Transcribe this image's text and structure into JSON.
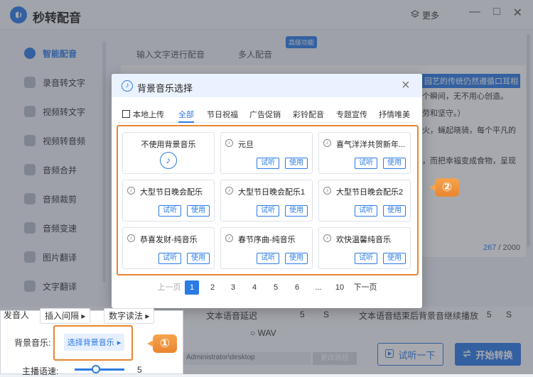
{
  "app": {
    "title": "秒转配音",
    "more": "更多"
  },
  "sidebar": {
    "items": [
      {
        "label": "智能配音",
        "active": true
      },
      {
        "label": "录音转文字"
      },
      {
        "label": "视频转文字"
      },
      {
        "label": "视频转音频"
      },
      {
        "label": "音频合并"
      },
      {
        "label": "音频裁剪"
      },
      {
        "label": "音频变速"
      },
      {
        "label": "图片翻译"
      },
      {
        "label": "文字翻译"
      }
    ]
  },
  "tabs": {
    "input_text": "输入文字进行配音",
    "multi": "多人配音",
    "badge": "高级功能"
  },
  "editor": {
    "highlight": "园艺的传统仍然遵循口耳相",
    "snip1": "个瞬间，无不用心创造。",
    "snip2": "劳和坚守。）",
    "snip3": "火，蝇起晓骑，每个平凡的",
    "snip4": "，而把幸福变成食物，呈现",
    "counter_current": "267",
    "counter_total": "/ 2000"
  },
  "bottom": {
    "insert_pause": "插入间隔",
    "number_read": "数字读法",
    "send_person": "发音人",
    "text_delay": "文本语音延迟",
    "delay_value": "5",
    "unit_s": "S",
    "bgm_continue": "文本语音结束后背景音继续播放",
    "continue_value": "5",
    "wav": "WAV",
    "speed_label": "主播语速:",
    "speed_value": "5",
    "path": "Administrator\\desktop",
    "change_path": "更改路径",
    "try_btn": "试听一下",
    "start_btn": "开始转换",
    "bgm_label": "背景音乐:",
    "bgm_select": "选择背景音乐",
    "speed_value2": "5"
  },
  "callouts": {
    "one": "①",
    "two": "②"
  },
  "modal": {
    "title": "背景音乐选择",
    "categories": [
      "本地上传",
      "全部",
      "节日祝福",
      "广告促销",
      "彩铃配音",
      "专题宣传",
      "抒情唯美"
    ],
    "active_category": "全部",
    "no_bgm": "不使用背景音乐",
    "listen": "试听",
    "use": "使用",
    "cards": [
      {
        "title": "元旦"
      },
      {
        "title": "喜气洋洋共贺新年..."
      },
      {
        "title": "大型节日晚会配乐"
      },
      {
        "title": "大型节日晚会配乐1"
      },
      {
        "title": "大型节日晚会配乐2"
      },
      {
        "title": "恭喜发财-纯音乐"
      },
      {
        "title": "春节序曲-纯音乐"
      },
      {
        "title": "欢快温馨纯音乐"
      }
    ],
    "pager": {
      "prev": "上一页",
      "pages": [
        "1",
        "2",
        "3",
        "4",
        "5",
        "6",
        "...",
        "10"
      ],
      "next": "下一页",
      "current": "1"
    }
  },
  "colors": {
    "accent": "#2c7be5",
    "callout": "#e9852f"
  }
}
